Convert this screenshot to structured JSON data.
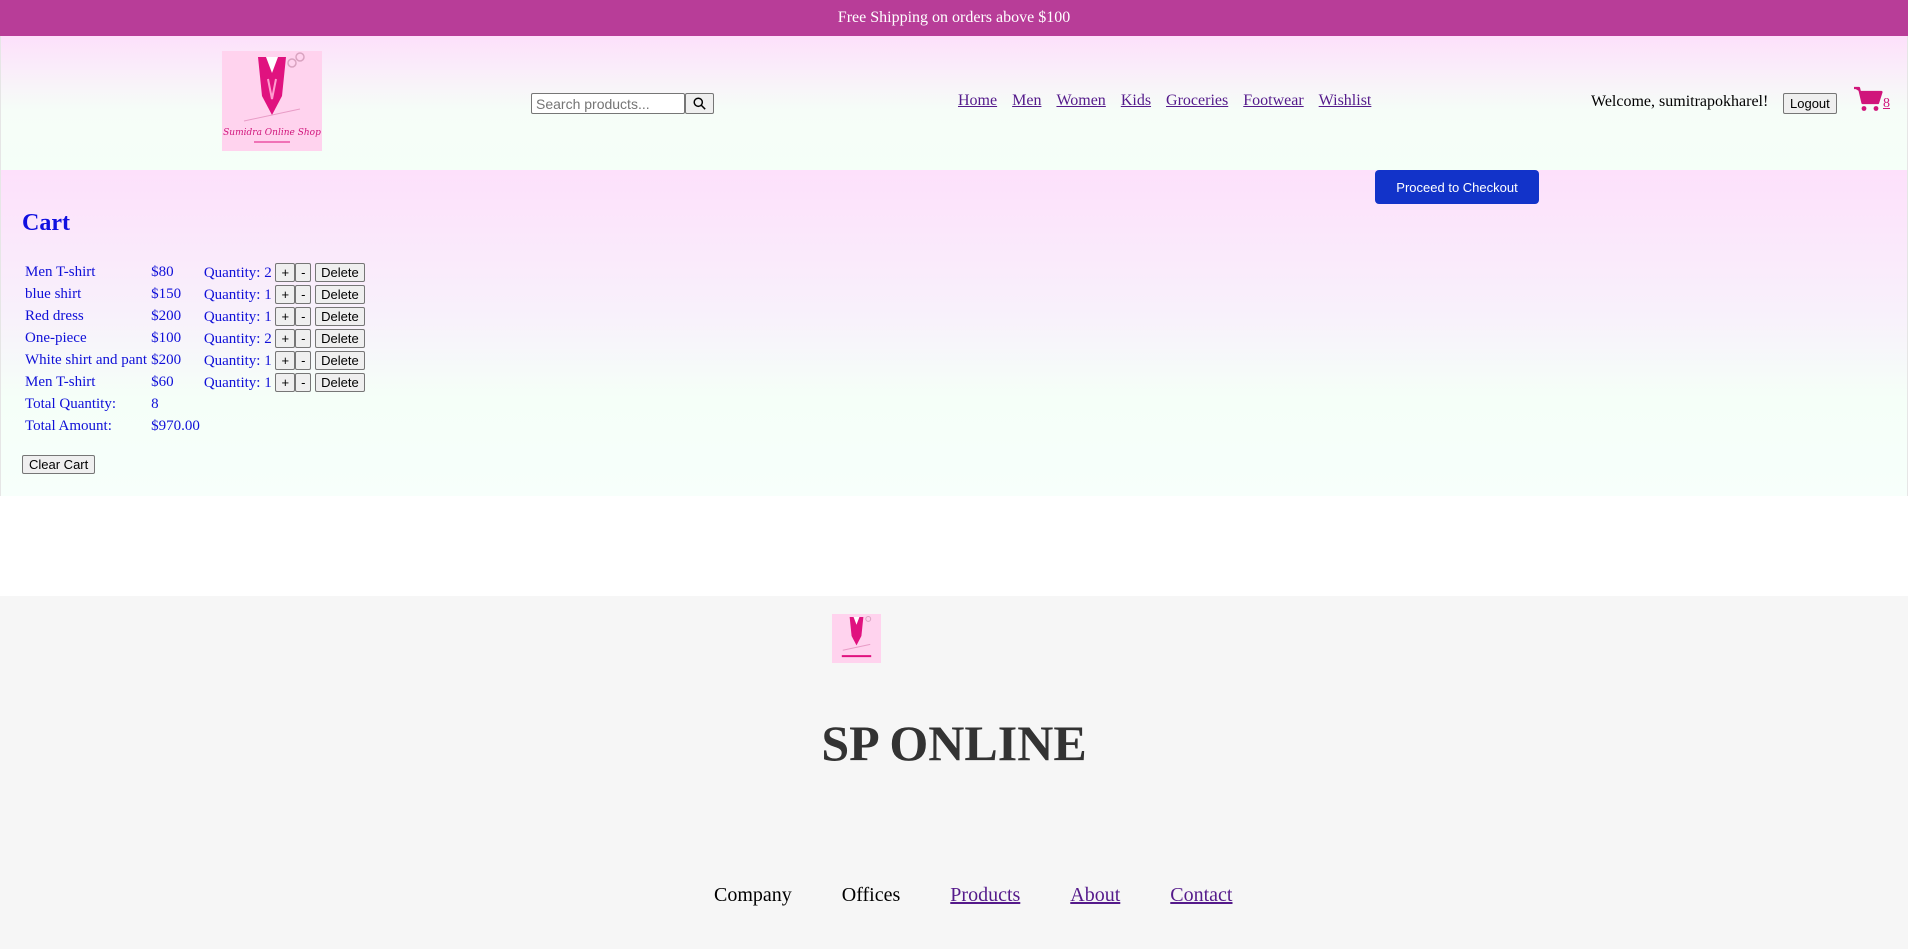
{
  "topbar": {
    "text": "Free Shipping on orders above $100"
  },
  "header": {
    "logo_icon": "shop-logo",
    "logo_text": "Sumidra Online Shop",
    "search": {
      "placeholder": "Search products...",
      "value": "",
      "icon": "search-icon"
    },
    "nav": [
      "Home",
      "Men",
      "Women",
      "Kids",
      "Groceries",
      "Footwear",
      "Wishlist"
    ],
    "welcome": "Welcome, sumitrapokharel!",
    "logout_label": "Logout",
    "cart_icon": "shopping-cart-icon",
    "cart_count": "8"
  },
  "cart": {
    "checkout_label": "Proceed to Checkout",
    "title": "Cart",
    "items": [
      {
        "name": "Men T-shirt",
        "price": "$80",
        "quantity": "Quantity: 2"
      },
      {
        "name": "blue shirt",
        "price": "$150",
        "quantity": "Quantity: 1"
      },
      {
        "name": "Red dress",
        "price": "$200",
        "quantity": "Quantity: 1"
      },
      {
        "name": "One-piece",
        "price": "$100",
        "quantity": "Quantity: 2"
      },
      {
        "name": "White shirt and pant",
        "price": "$200",
        "quantity": "Quantity: 1"
      },
      {
        "name": "Men T-shirt",
        "price": "$60",
        "quantity": "Quantity: 1"
      }
    ],
    "plus_label": "+",
    "minus_label": "-",
    "delete_label": "Delete",
    "total_quantity_label": "Total Quantity:",
    "total_quantity": "8",
    "total_amount_label": "Total Amount:",
    "total_amount": "$970.00",
    "clear_label": "Clear Cart"
  },
  "footer": {
    "brand": "SP ONLINE",
    "company": "Company",
    "offices": "Offices",
    "links": [
      "Products",
      "About",
      "Contact"
    ]
  },
  "colors": {
    "topbar": "#b83d98",
    "accent_pink": "#d0157b",
    "checkout_blue": "#1233c9",
    "cart_text": "#1010d8"
  }
}
